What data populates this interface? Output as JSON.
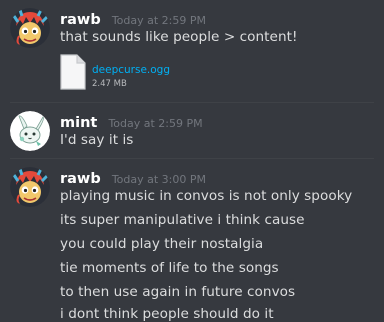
{
  "messages": [
    {
      "username": "rawb",
      "timestamp": "Today at 2:59 PM",
      "avatar": "rawb-avatar",
      "lines": [
        "that sounds like people > content!"
      ],
      "attachment": {
        "name": "deepcurse.ogg",
        "size": "2.47 MB",
        "icon": "file-icon"
      }
    },
    {
      "username": "mint",
      "timestamp": "Today at 2:59 PM",
      "avatar": "mint-avatar",
      "lines": [
        "I'd say it is"
      ]
    },
    {
      "username": "rawb",
      "timestamp": "Today at 3:00 PM",
      "avatar": "rawb-avatar",
      "lines": [
        "playing music in convos is not only spooky",
        "its super manipulative i think cause",
        "you could play their nostalgia",
        "tie moments of life to the songs",
        "to then use again in future convos",
        "i dont think people should do it"
      ]
    }
  ],
  "colors": {
    "background": "#36393f",
    "username": "#ffffff",
    "timestamp": "#72767d",
    "text": "#dcddde",
    "link": "#00b0f4"
  }
}
